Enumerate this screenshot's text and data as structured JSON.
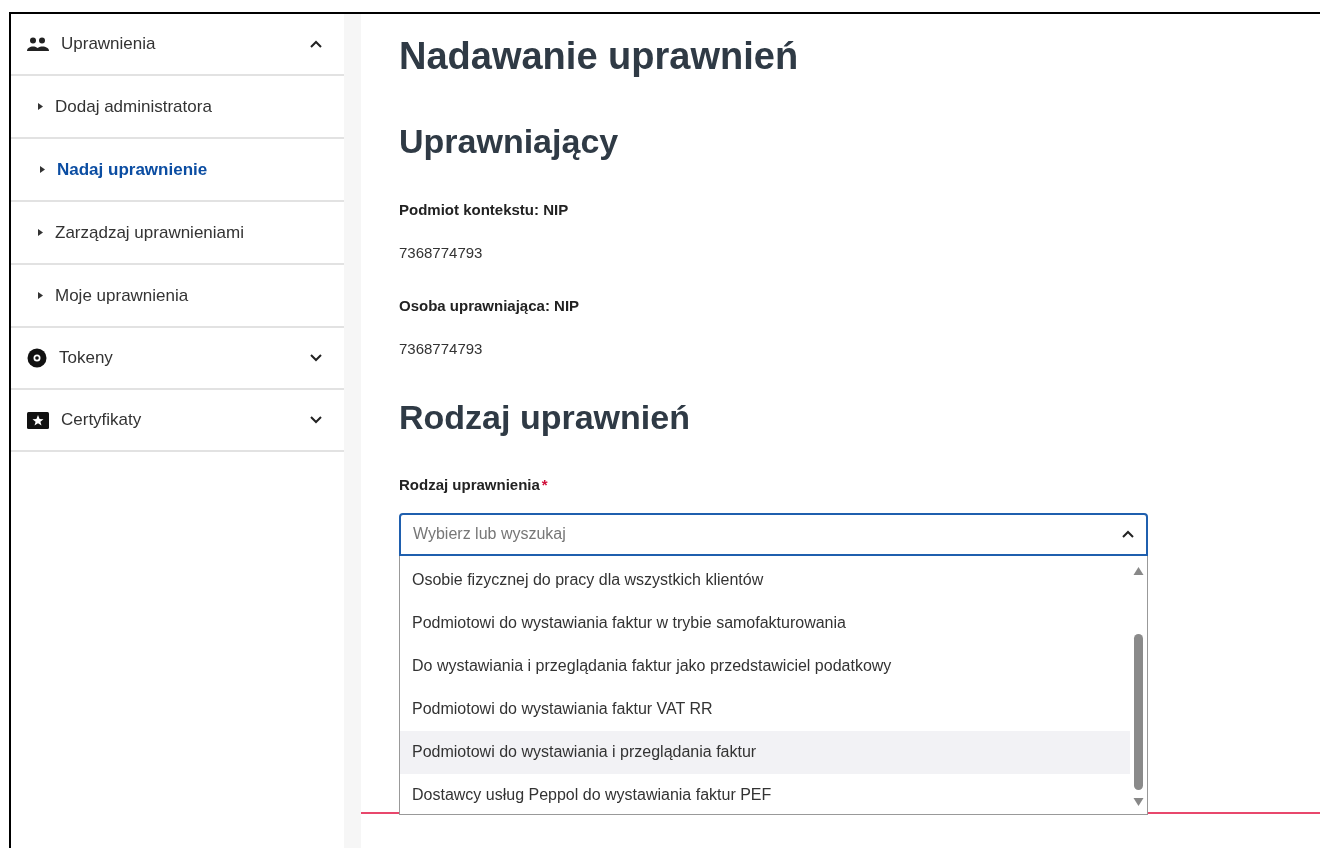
{
  "sidebar": {
    "groups": [
      {
        "label": "Uprawnienia",
        "expanded": true,
        "items": [
          {
            "label": "Dodaj administratora",
            "selected": false
          },
          {
            "label": "Nadaj uprawnienie",
            "selected": true
          },
          {
            "label": "Zarządzaj uprawnieniami",
            "selected": false
          },
          {
            "label": "Moje uprawnienia",
            "selected": false
          }
        ]
      },
      {
        "label": "Tokeny",
        "expanded": false
      },
      {
        "label": "Certyfikaty",
        "expanded": false
      }
    ]
  },
  "page_title": "Nadawanie uprawnień",
  "sections": [
    {
      "heading": "Uprawniający",
      "fields": [
        {
          "label": "Podmiot kontekstu: NIP",
          "value": "7368774793"
        },
        {
          "label": "Osoba uprawniająca: NIP",
          "value": "7368774793"
        }
      ]
    },
    {
      "heading": "Rodzaj uprawnień",
      "select": {
        "label": "Rodzaj uprawnienia",
        "required_mark": "*",
        "placeholder": "Wybierz lub wyszukaj",
        "expanded": true,
        "options": [
          {
            "label": "Osobie fizycznej do pracy dla wszystkich klientów",
            "highlighted": false
          },
          {
            "label": "Podmiotowi do wystawiania faktur w trybie samofakturowania",
            "highlighted": false
          },
          {
            "label": "Do wystawiania i przeglądania faktur jako przedstawiciel podatkowy",
            "highlighted": false
          },
          {
            "label": "Podmiotowi do wystawiania faktur VAT RR",
            "highlighted": false
          },
          {
            "label": "Podmiotowi do wystawiania i przeglądania faktur",
            "highlighted": true
          },
          {
            "label": "Dostawcy usług Peppol do wystawiania faktur PEF",
            "highlighted": false
          }
        ]
      }
    }
  ]
}
